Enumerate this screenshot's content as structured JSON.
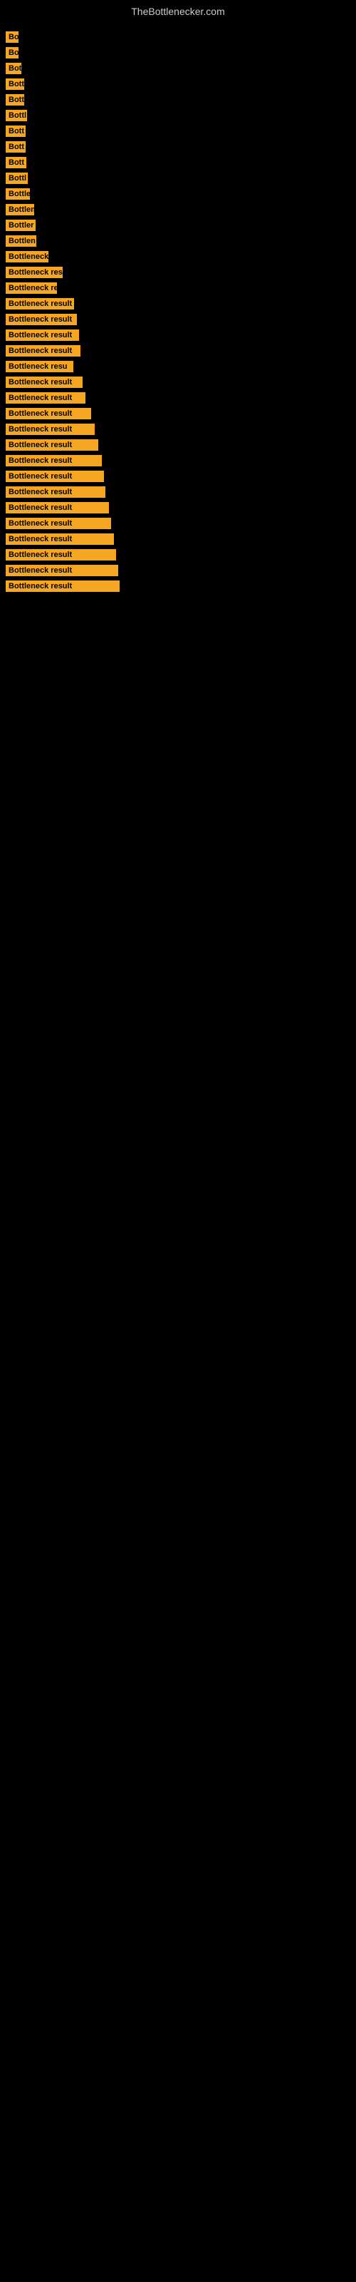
{
  "site": {
    "title": "TheBottlenecker.com"
  },
  "bars": [
    {
      "label": "Bo",
      "width": 18
    },
    {
      "label": "Bo",
      "width": 18
    },
    {
      "label": "Bot",
      "width": 22
    },
    {
      "label": "Bott",
      "width": 26
    },
    {
      "label": "Bott",
      "width": 26
    },
    {
      "label": "Bottl",
      "width": 30
    },
    {
      "label": "Bott",
      "width": 28
    },
    {
      "label": "Bott",
      "width": 28
    },
    {
      "label": "Bott",
      "width": 29
    },
    {
      "label": "Bottl",
      "width": 31
    },
    {
      "label": "Bottle",
      "width": 34
    },
    {
      "label": "Bottlen",
      "width": 40
    },
    {
      "label": "Bottler",
      "width": 42
    },
    {
      "label": "Bottlen",
      "width": 43
    },
    {
      "label": "Bottleneck r",
      "width": 60
    },
    {
      "label": "Bottleneck resu",
      "width": 80
    },
    {
      "label": "Bottleneck re",
      "width": 72
    },
    {
      "label": "Bottleneck result",
      "width": 96
    },
    {
      "label": "Bottleneck result",
      "width": 100
    },
    {
      "label": "Bottleneck result",
      "width": 103
    },
    {
      "label": "Bottleneck result",
      "width": 105
    },
    {
      "label": "Bottleneck resu",
      "width": 95
    },
    {
      "label": "Bottleneck result",
      "width": 108
    },
    {
      "label": "Bottleneck result",
      "width": 112
    },
    {
      "label": "Bottleneck result",
      "width": 120
    },
    {
      "label": "Bottleneck result",
      "width": 125
    },
    {
      "label": "Bottleneck result",
      "width": 130
    },
    {
      "label": "Bottleneck result",
      "width": 135
    },
    {
      "label": "Bottleneck result",
      "width": 138
    },
    {
      "label": "Bottleneck result",
      "width": 140
    },
    {
      "label": "Bottleneck result",
      "width": 145
    },
    {
      "label": "Bottleneck result",
      "width": 148
    },
    {
      "label": "Bottleneck result",
      "width": 152
    },
    {
      "label": "Bottleneck result",
      "width": 155
    },
    {
      "label": "Bottleneck result",
      "width": 158
    },
    {
      "label": "Bottleneck result",
      "width": 160
    }
  ]
}
